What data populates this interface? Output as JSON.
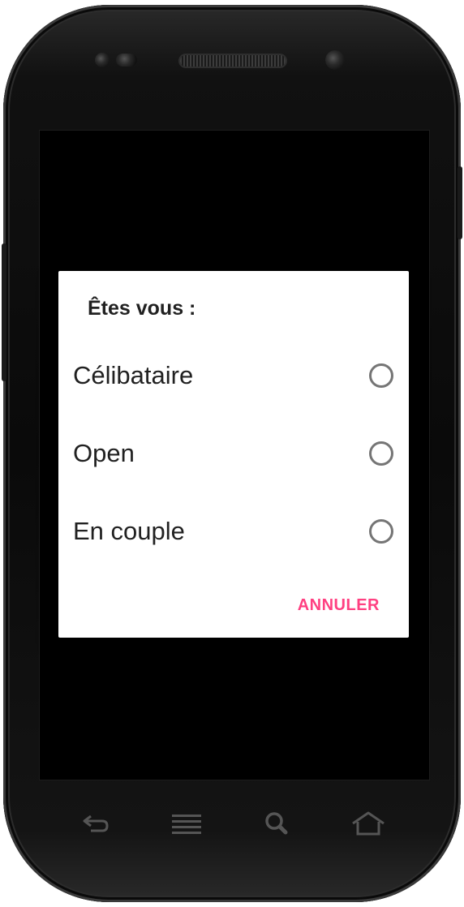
{
  "dialog": {
    "title": "Êtes vous :",
    "options": [
      {
        "label": "Célibataire",
        "selected": false
      },
      {
        "label": "Open",
        "selected": false
      },
      {
        "label": "En couple",
        "selected": false
      }
    ],
    "cancel_label": "ANNULER"
  },
  "navbar": {
    "keys": [
      "back-icon",
      "menu-icon",
      "search-icon",
      "home-icon"
    ]
  },
  "colors": {
    "accent": "#ff4081",
    "radio_border": "#757575",
    "text": "#212121",
    "scrim": "#000000"
  }
}
